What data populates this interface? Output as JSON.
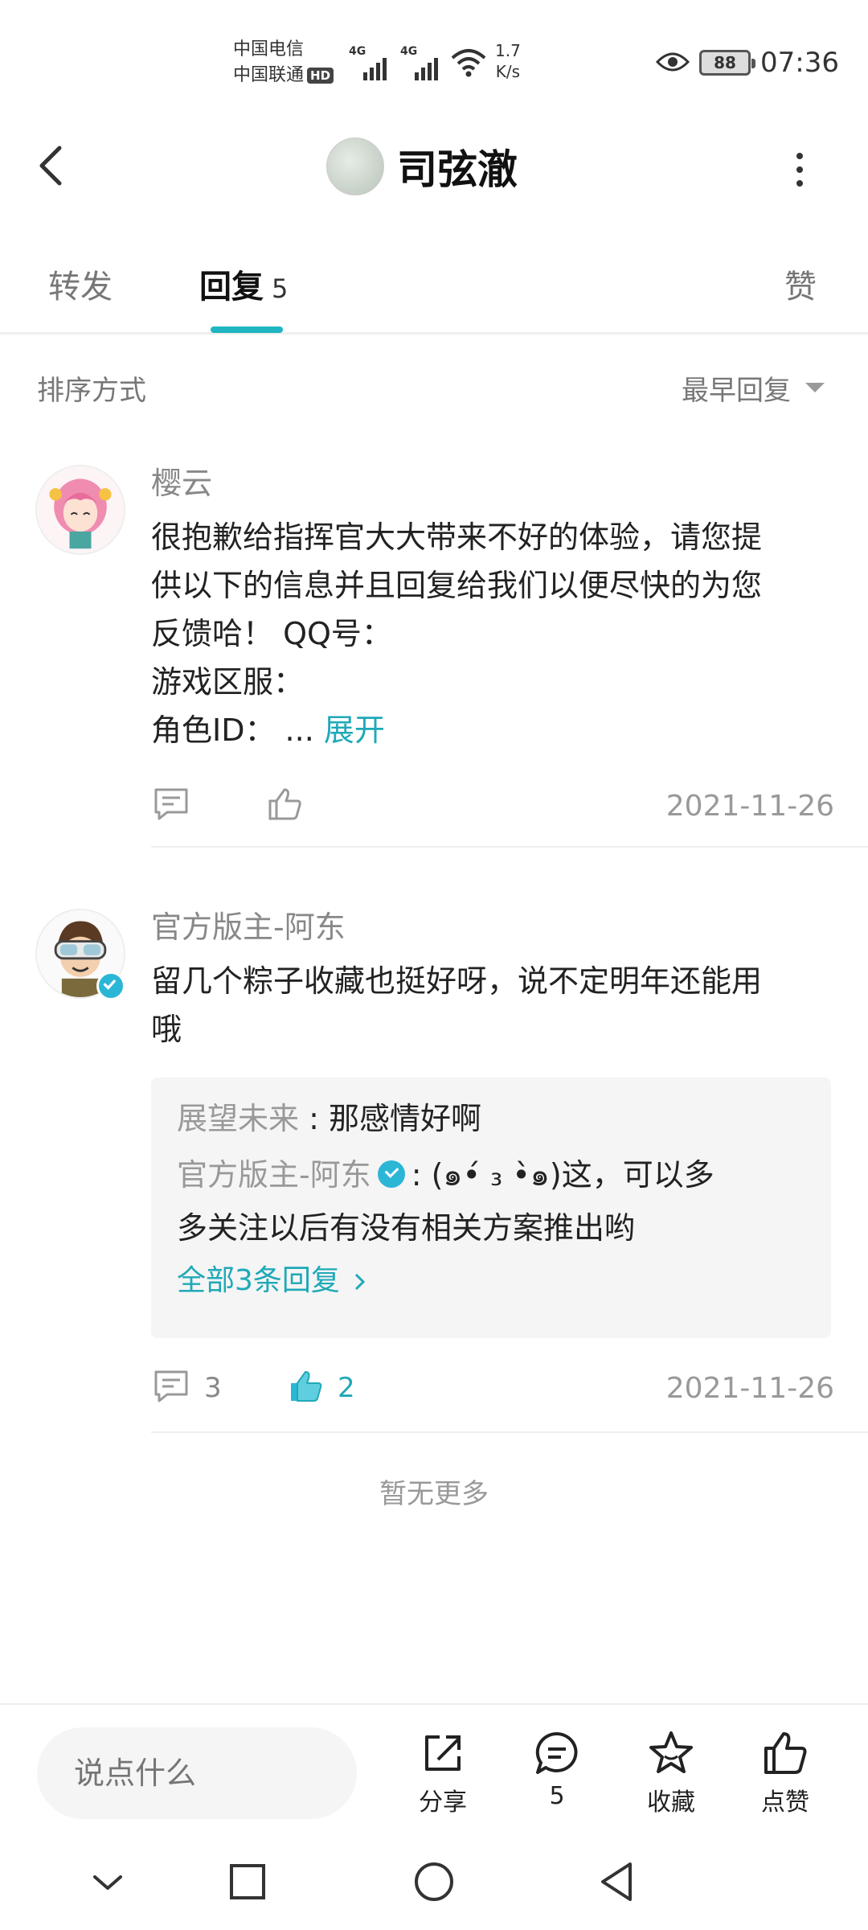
{
  "status_bar": {
    "carrier_1": "中国电信",
    "carrier_2": "中国联通",
    "hd": "HD",
    "signal_tag_1": "4G",
    "signal_tag_2": "4G",
    "net_speed_value": "1.7",
    "net_speed_unit": "K/s",
    "battery": "88",
    "time": "07:36"
  },
  "header": {
    "title": "司弦澈"
  },
  "tabs": [
    {
      "label": "转发",
      "count": ""
    },
    {
      "label": "回复",
      "count": "5"
    },
    {
      "label": "赞",
      "count": ""
    }
  ],
  "sort": {
    "label": "排序方式",
    "value": "最早回复"
  },
  "comments": [
    {
      "username": "樱云",
      "line_1": "很抱歉给指挥官大大带来不好的体验，请您提",
      "line_2": "供以下的信息并且回复给我们以便尽快的为您",
      "line_3": "反馈哈！  QQ号：",
      "line_4": "游戏区服：",
      "line_5": "角色ID：   ... ",
      "expand": "展开",
      "reply_count": "",
      "like_count": "",
      "date": "2021-11-26"
    },
    {
      "username": "官方版主-阿东",
      "line_1": "留几个粽子收藏也挺好呀，说不定明年还能用",
      "line_2": "哦",
      "replies": [
        {
          "name": "展望未来",
          "text": "那感情好啊"
        },
        {
          "name": "官方版主-阿东",
          "text": "(๑•́ ₃ •̀๑)这，可以多",
          "cont": "多关注以后有没有相关方案推出哟"
        }
      ],
      "all_replies": "全部3条回复",
      "reply_count": "3",
      "like_count": "2",
      "date": "2021-11-26"
    }
  ],
  "no_more": "暂无更多",
  "bottom_bar": {
    "input_placeholder": "说点什么",
    "share": "分享",
    "comments": "5",
    "favorite": "收藏",
    "like": "点赞"
  },
  "colors": {
    "accent": "#1fa9b8",
    "verified": "#2bb6d6"
  }
}
